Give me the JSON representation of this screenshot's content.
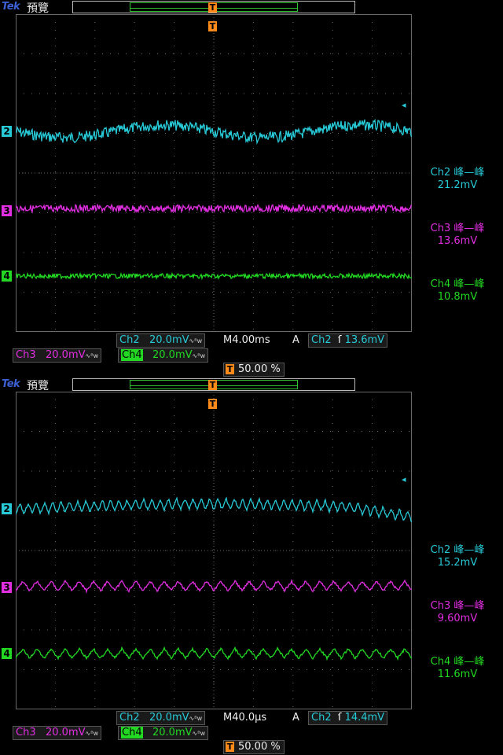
{
  "scopes": [
    {
      "brand": "Tek",
      "mode": "預覽",
      "channels": [
        {
          "id": "2",
          "color": "#27c9d6"
        },
        {
          "id": "3",
          "color": "#e02ee0"
        },
        {
          "id": "4",
          "color": "#22d822"
        }
      ],
      "measurements": [
        {
          "label": "Ch2 峰—峰",
          "value": "21.2mV",
          "color": "#27c9d6"
        },
        {
          "label": "Ch3 峰—峰",
          "value": "13.6mV",
          "color": "#e02ee0"
        },
        {
          "label": "Ch4 峰—峰",
          "value": "10.8mV",
          "color": "#22d822"
        }
      ],
      "status": {
        "ch2_label": "Ch2",
        "ch2_scale": "20.0mV",
        "ch3_label": "Ch3",
        "ch3_scale": "20.0mV",
        "ch4_label": "Ch4",
        "ch4_scale": "20.0mV",
        "timebase": "M4.00ms",
        "trigger_mode": "A",
        "trigger_source": "Ch2",
        "trigger_level": "13.6mV",
        "trigger_position": "50.00 %",
        "bw_symbol": "∿ᴮw"
      }
    },
    {
      "brand": "Tek",
      "mode": "預覽",
      "channels": [
        {
          "id": "2",
          "color": "#27c9d6"
        },
        {
          "id": "3",
          "color": "#e02ee0"
        },
        {
          "id": "4",
          "color": "#22d822"
        }
      ],
      "measurements": [
        {
          "label": "Ch2 峰—峰",
          "value": "15.2mV",
          "color": "#27c9d6"
        },
        {
          "label": "Ch3 峰—峰",
          "value": "9.60mV",
          "color": "#e02ee0"
        },
        {
          "label": "Ch4 峰—峰",
          "value": "11.6mV",
          "color": "#22d822"
        }
      ],
      "status": {
        "ch2_label": "Ch2",
        "ch2_scale": "20.0mV",
        "ch3_label": "Ch3",
        "ch3_scale": "20.0mV",
        "ch4_label": "Ch4",
        "ch4_scale": "20.0mV",
        "timebase": "M40.0µs",
        "trigger_mode": "A",
        "trigger_source": "Ch2",
        "trigger_level": "14.4mV",
        "trigger_position": "50.00 %",
        "bw_symbol": "∿ᴮw"
      }
    }
  ],
  "colors": {
    "ch2": "#27c9d6",
    "ch3": "#e02ee0",
    "ch4": "#22d822",
    "trigger": "#ff8a1a",
    "grid": "#6a6a6a",
    "brand": "#3d5fd6"
  }
}
